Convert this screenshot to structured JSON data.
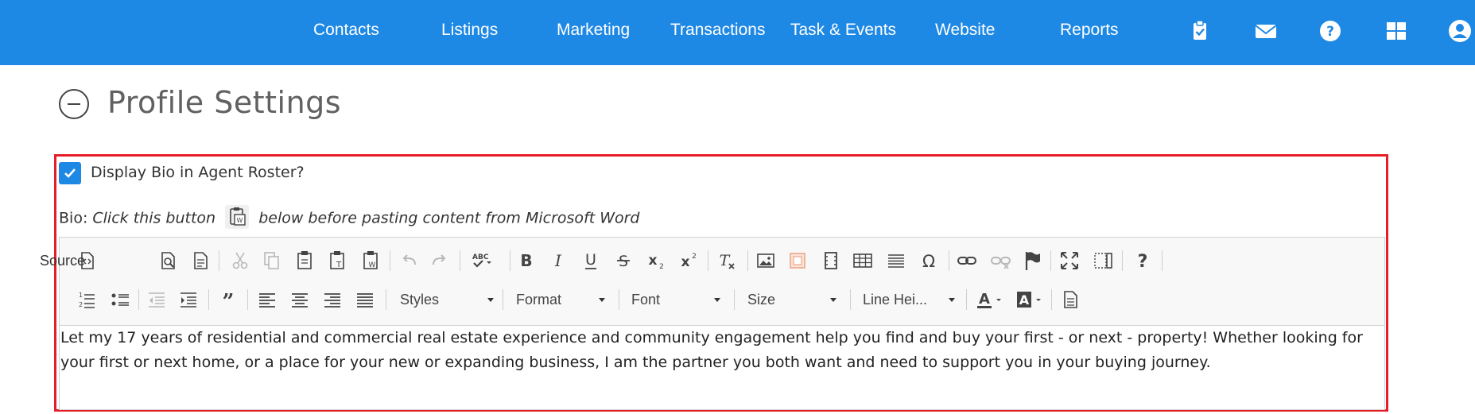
{
  "nav": {
    "links": [
      "Contacts",
      "Listings",
      "Marketing",
      "Transactions",
      "Task & Events",
      "Website",
      "Reports"
    ],
    "icons": [
      "clipboard-check-icon",
      "envelope-icon",
      "help-icon",
      "apps-grid-icon",
      "user-account-icon"
    ],
    "bg_color": "#1e88e5"
  },
  "page": {
    "title": "Profile Settings",
    "highlight_color": "#e61e29"
  },
  "form": {
    "display_bio_label": "Display Bio in Agent Roster?",
    "display_bio_checked": true,
    "bio_label": "Bio:",
    "bio_hint_before": "Click this button",
    "bio_hint_after": "below before pasting content from Microsoft Word"
  },
  "editor": {
    "source_label": "Source",
    "toolbar_row1": [
      "source-icon",
      "preview-icon",
      "templates-icon",
      "cut-icon",
      "copy-icon",
      "paste-icon",
      "paste-text-icon",
      "paste-from-word-icon",
      "undo-icon",
      "redo-icon",
      "spellcheck-icon",
      "bold-icon",
      "italic-icon",
      "underline-icon",
      "strikethrough-icon",
      "subscript-icon",
      "superscript-icon",
      "remove-format-icon",
      "image-icon",
      "flash-icon",
      "video-icon",
      "table-icon",
      "horizontal-rule-icon",
      "special-char-icon",
      "link-icon",
      "unlink-icon",
      "anchor-icon",
      "maximize-icon",
      "show-blocks-icon",
      "about-icon"
    ],
    "toolbar_row2": [
      "numbered-list-icon",
      "bulleted-list-icon",
      "decrease-indent-icon",
      "increase-indent-icon",
      "blockquote-icon",
      "align-left-icon",
      "align-center-icon",
      "align-right-icon",
      "justify-icon",
      "text-color-icon",
      "background-color-icon",
      "document-icon"
    ],
    "combos": {
      "styles": "Styles",
      "format": "Format",
      "font": "Font",
      "size": "Size",
      "line_height": "Line Hei..."
    },
    "content": "Let my 17 years of residential and commercial real estate experience and community engagement help you find and buy your first - or next - property! Whether looking for your first or next home, or a place for your new or expanding business, I am the partner you both want and need to support you in your buying journey."
  }
}
